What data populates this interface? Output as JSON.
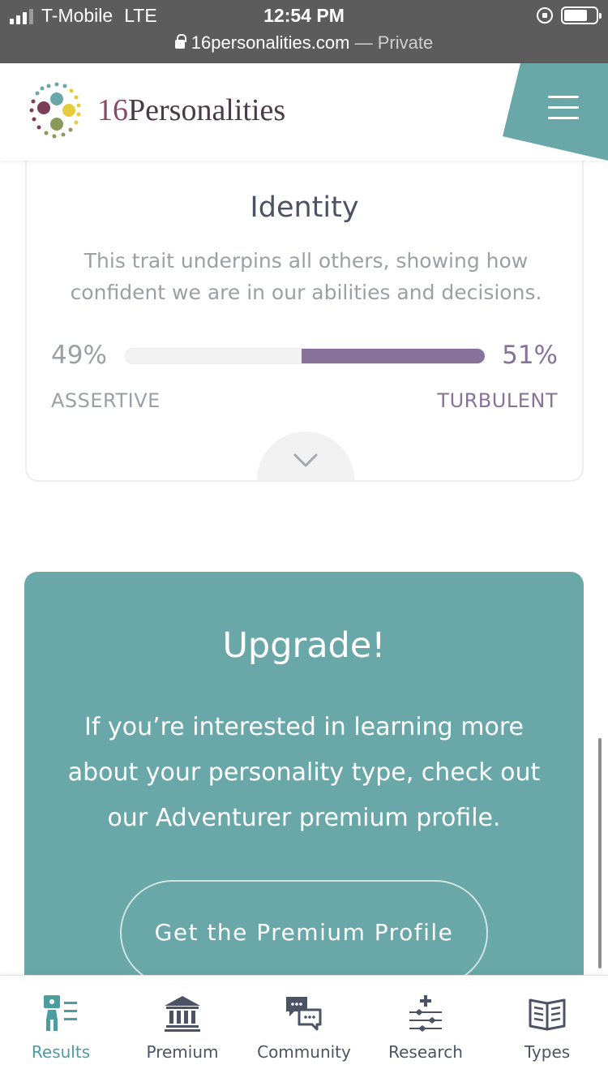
{
  "status_bar": {
    "carrier": "T-Mobile",
    "network": "LTE",
    "time": "12:54 PM",
    "url": "16personalities.com",
    "url_separator": "—",
    "mode": "Private"
  },
  "header": {
    "brand_number": "16",
    "brand_name": "Personalities",
    "accent_color": "#6aa7a9"
  },
  "trait_card": {
    "title": "Identity",
    "description": "This trait underpins all others, showing how confident we are in our abilities and decisions.",
    "left_percent": "49%",
    "right_percent": "51%",
    "left_label": "ASSERTIVE",
    "right_label": "TURBULENT",
    "dominant_fraction": 0.51,
    "bar_color": "#88729a"
  },
  "upgrade": {
    "title": "Upgrade!",
    "text": "If you’re interested in learning more about your personality type, check out our Adventurer premium profile.",
    "button_label": "Get the Premium Profile",
    "background_color": "#6aa7a9"
  },
  "bottom_nav": {
    "items": [
      {
        "label": "Results",
        "icon": "results-icon",
        "active": true
      },
      {
        "label": "Premium",
        "icon": "premium-bank-icon",
        "active": false
      },
      {
        "label": "Community",
        "icon": "community-chat-icon",
        "active": false
      },
      {
        "label": "Research",
        "icon": "research-sliders-icon",
        "active": false
      },
      {
        "label": "Types",
        "icon": "types-book-icon",
        "active": false
      }
    ],
    "active_color": "#4d9da0"
  }
}
